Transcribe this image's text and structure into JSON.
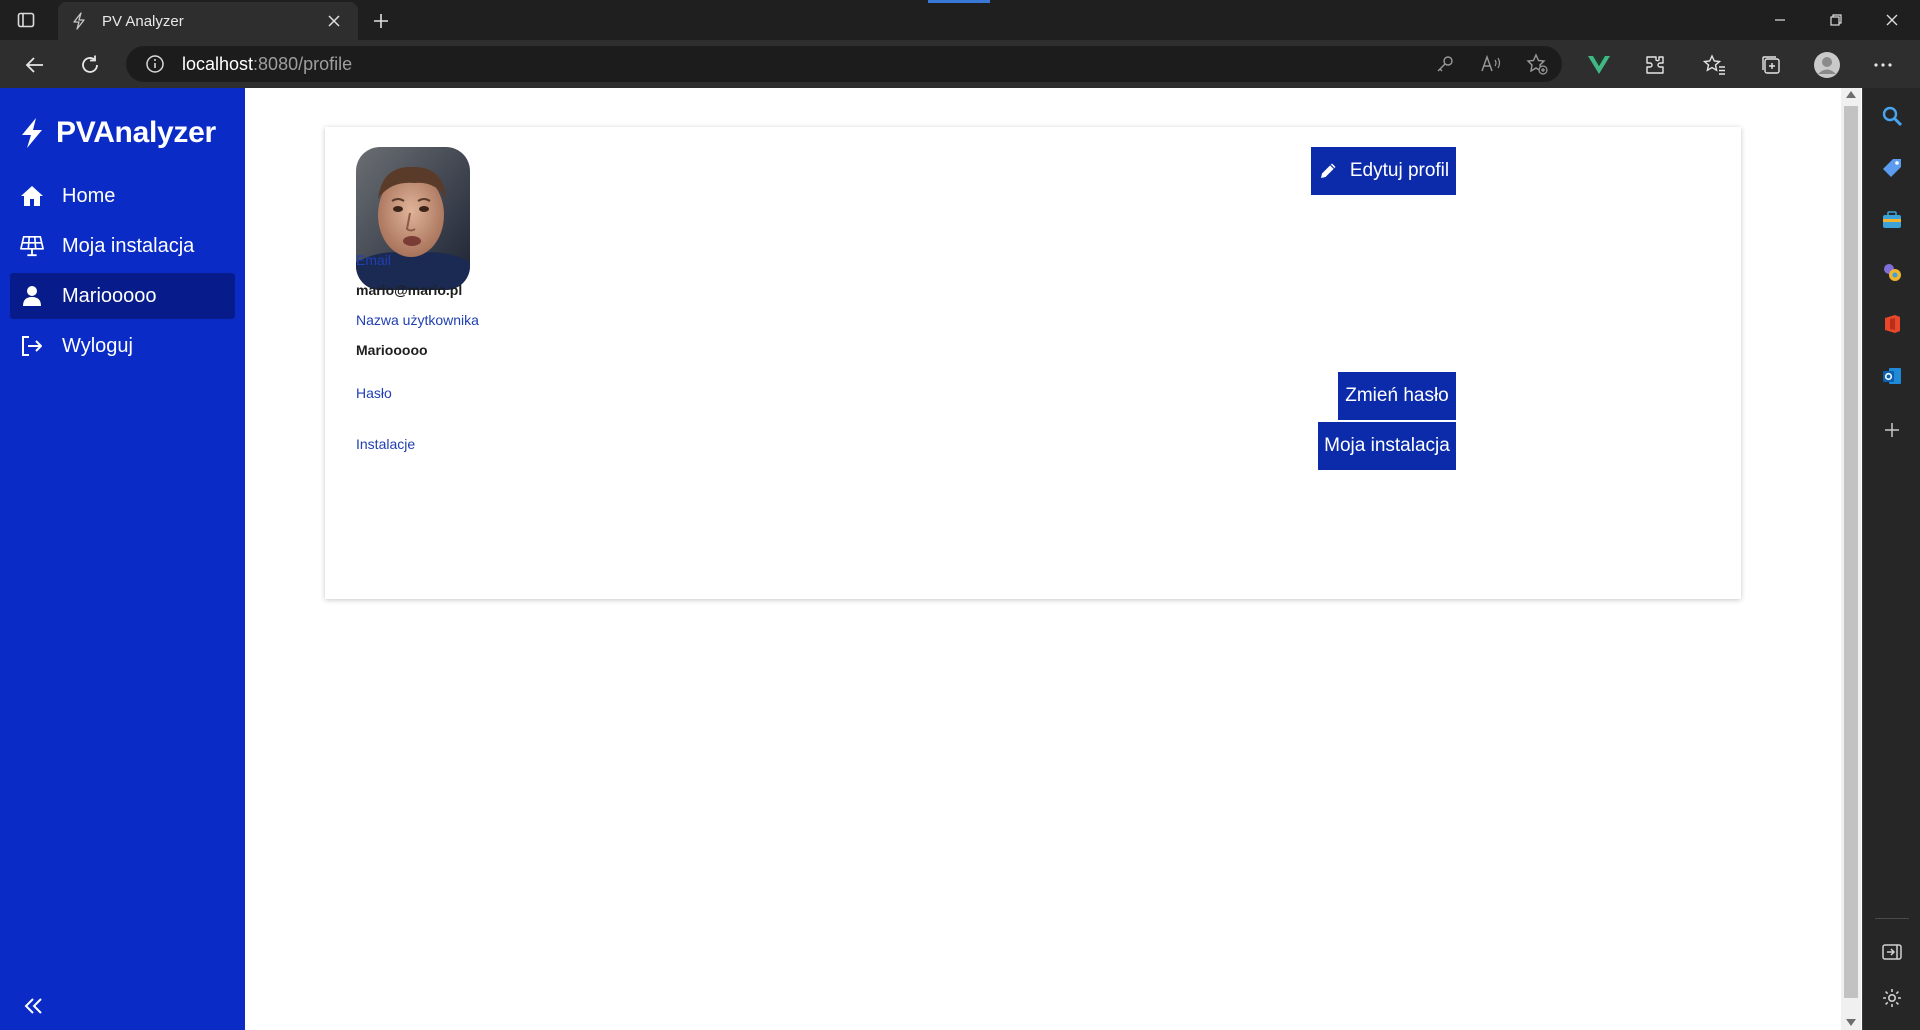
{
  "browser": {
    "tab_title": "PV Analyzer",
    "url_host": "localhost",
    "url_path": ":8080/profile",
    "accent": "#3a78d8"
  },
  "sidebar": {
    "brand": "PVAnalyzer",
    "color": "#0b2bc6",
    "items": [
      {
        "label": "Home",
        "icon": "home-icon",
        "active": false
      },
      {
        "label": "Moja instalacja",
        "icon": "solar-panel-icon",
        "active": false
      },
      {
        "label": "Mariooooo",
        "icon": "user-icon",
        "active": true
      },
      {
        "label": "Wyloguj",
        "icon": "logout-icon",
        "active": false
      }
    ]
  },
  "profile": {
    "edit_button": "Edytuj profil",
    "email_label": "Email",
    "email_value": "mario@mario.pl",
    "username_label": "Nazwa użytkownika",
    "username_value": "Mariooooo",
    "password_label": "Hasło",
    "change_password_button": "Zmień hasło",
    "installations_label": "Instalacje",
    "installation_button": "Moja instalacja",
    "button_color": "#0b2bab",
    "label_color": "#1f3fb3"
  }
}
